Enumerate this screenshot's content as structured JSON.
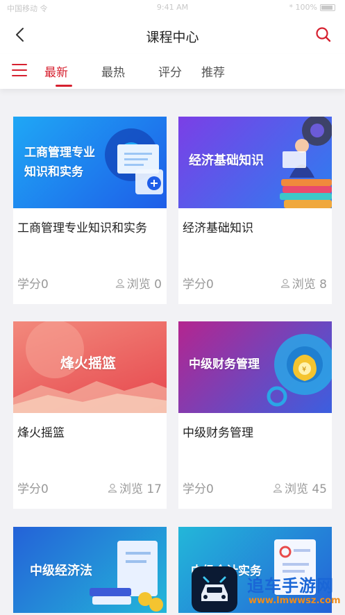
{
  "status_bar": {
    "left": "中国移动 令",
    "center": "9:41 AM",
    "right": "* 100%"
  },
  "header": {
    "title": "课程中心",
    "back_icon": "chevron-left-icon",
    "search_icon": "search-icon"
  },
  "tabs": [
    {
      "label": "最新",
      "active": true
    },
    {
      "label": "最热",
      "active": false
    },
    {
      "label": "评分",
      "active": false
    },
    {
      "label": "推荐",
      "active": false
    }
  ],
  "colors": {
    "accent": "#d6202f",
    "background": "#f2f2f5"
  },
  "courses": [
    {
      "banner_text": "工商管理专业\n知识和实务",
      "title": "工商管理专业知识和实务",
      "credit": "学分0",
      "views": "浏览 0",
      "banner_gradient": [
        "#1fa7f5",
        "#1e5de8"
      ]
    },
    {
      "banner_text": "经济基础知识",
      "title": "经济基础知识",
      "credit": "学分0",
      "views": "浏览 8",
      "banner_gradient": [
        "#7b3fe6",
        "#2c7ff0"
      ]
    },
    {
      "banner_text": "烽火摇篮",
      "title": "烽火摇篮",
      "credit": "学分0",
      "views": "浏览 17",
      "banner_gradient": [
        "#f07a6e",
        "#e8484a"
      ]
    },
    {
      "banner_text": "中级财务管理",
      "title": "中级财务管理",
      "credit": "学分0",
      "views": "浏览 45",
      "banner_gradient": [
        "#b4258f",
        "#3b5fe0"
      ]
    },
    {
      "banner_text": "中级经济法",
      "title": "",
      "credit": "",
      "views": "",
      "banner_gradient": [
        "#2462d8",
        "#23b7d9"
      ]
    },
    {
      "banner_text": "中级会计实务",
      "title": "",
      "credit": "",
      "views": "",
      "banner_gradient": [
        "#23b7d9",
        "#2462d8"
      ]
    }
  ],
  "watermark": {
    "text_main": "追车手游网",
    "text_url": "www.lmwwsz.com"
  }
}
